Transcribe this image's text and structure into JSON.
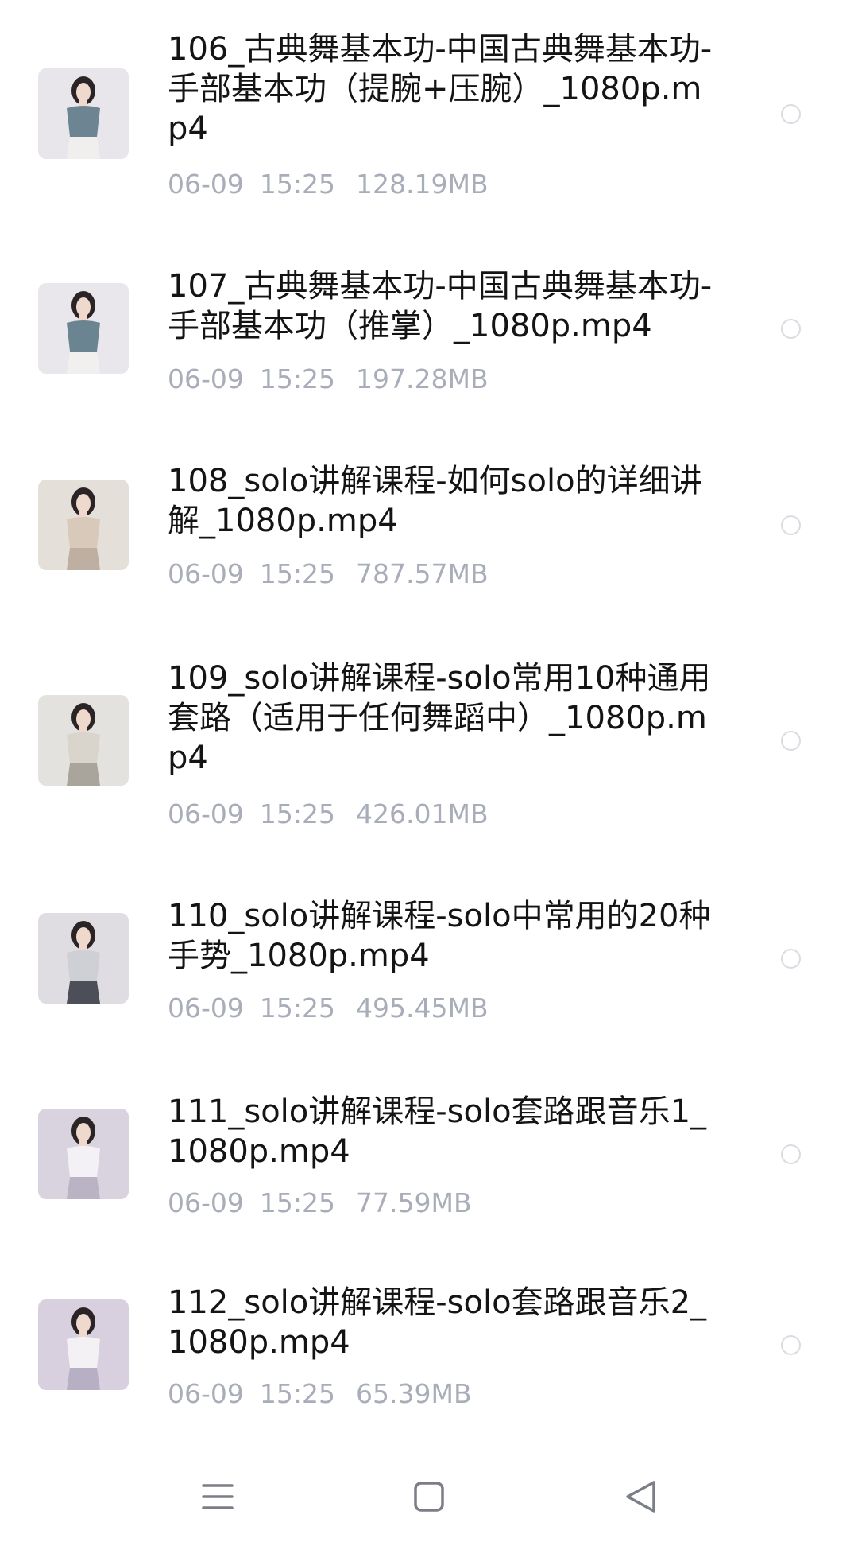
{
  "files": [
    {
      "name": "106_古典舞基本功-中国古典舞基本功-手部基本功（提腕+压腕）_1080p.mp4",
      "date": "06-09",
      "time": "15:25",
      "size": "128.19MB",
      "thumb": "dancer-blue-outfit",
      "thumb_colors": [
        "#e8e6ea",
        "#6d8593",
        "#f1efee"
      ]
    },
    {
      "name": "107_古典舞基本功-中国古典舞基本功-手部基本功（推掌）_1080p.mp4",
      "date": "06-09",
      "time": "15:25",
      "size": "197.28MB",
      "thumb": "dancer-blue-outfit",
      "thumb_colors": [
        "#e9e7ec",
        "#6b8491",
        "#f2f0ef"
      ]
    },
    {
      "name": "108_solo讲解课程-如何solo的详细讲解_1080p.mp4",
      "date": "06-09",
      "time": "15:25",
      "size": "787.57MB",
      "thumb": "dancer-beige-top",
      "thumb_colors": [
        "#e5dfd9",
        "#d8c9bb",
        "#bfaea2"
      ]
    },
    {
      "name": "109_solo讲解课程-solo常用10种通用套路（适用于任何舞蹈中）_1080p.mp4",
      "date": "06-09",
      "time": "15:25",
      "size": "426.01MB",
      "thumb": "dancer-knit-top",
      "thumb_colors": [
        "#e4e2de",
        "#d9d5cd",
        "#a9a49c"
      ]
    },
    {
      "name": "110_solo讲解课程-solo中常用的20种手势_1080p.mp4",
      "date": "06-09",
      "time": "15:25",
      "size": "495.45MB",
      "thumb": "dancer-crop-top",
      "thumb_colors": [
        "#dfdde2",
        "#cfd0d5",
        "#4d4f58"
      ]
    },
    {
      "name": "111_solo讲解课程-solo套路跟音乐1_1080p.mp4",
      "date": "06-09",
      "time": "15:25",
      "size": "77.59MB",
      "thumb": "dancer-white-outfit",
      "thumb_colors": [
        "#d9d3e0",
        "#f3f1f5",
        "#b9b3c4"
      ]
    },
    {
      "name": "112_solo讲解课程-solo套路跟音乐2_1080p.mp4",
      "date": "06-09",
      "time": "15:25",
      "size": "65.39MB",
      "thumb": "dancer-white-outfit",
      "thumb_colors": [
        "#d8d0de",
        "#f4f1f5",
        "#b7afc3"
      ]
    }
  ],
  "nav": {
    "menu": "menu-icon",
    "home": "home-square-icon",
    "back": "back-triangle-icon",
    "icon_color": "#7b7e86"
  }
}
